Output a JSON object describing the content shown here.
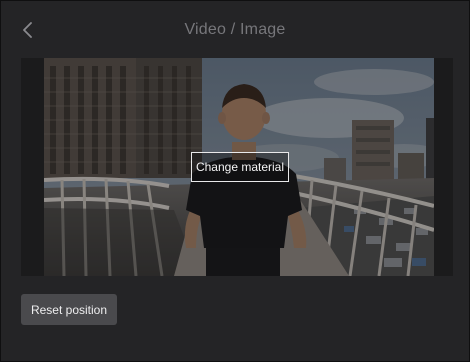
{
  "header": {
    "title": "Video / Image",
    "back_icon": "chevron-left-icon"
  },
  "preview": {
    "change_material_label": "Change material"
  },
  "footer": {
    "reset_position_label": "Reset position"
  },
  "colors": {
    "panel_background": "#242426",
    "title_text": "#77777b",
    "button_background": "#4a4a4d",
    "button_text": "#eeeeef",
    "overlay_border": "#e9e9ea"
  }
}
